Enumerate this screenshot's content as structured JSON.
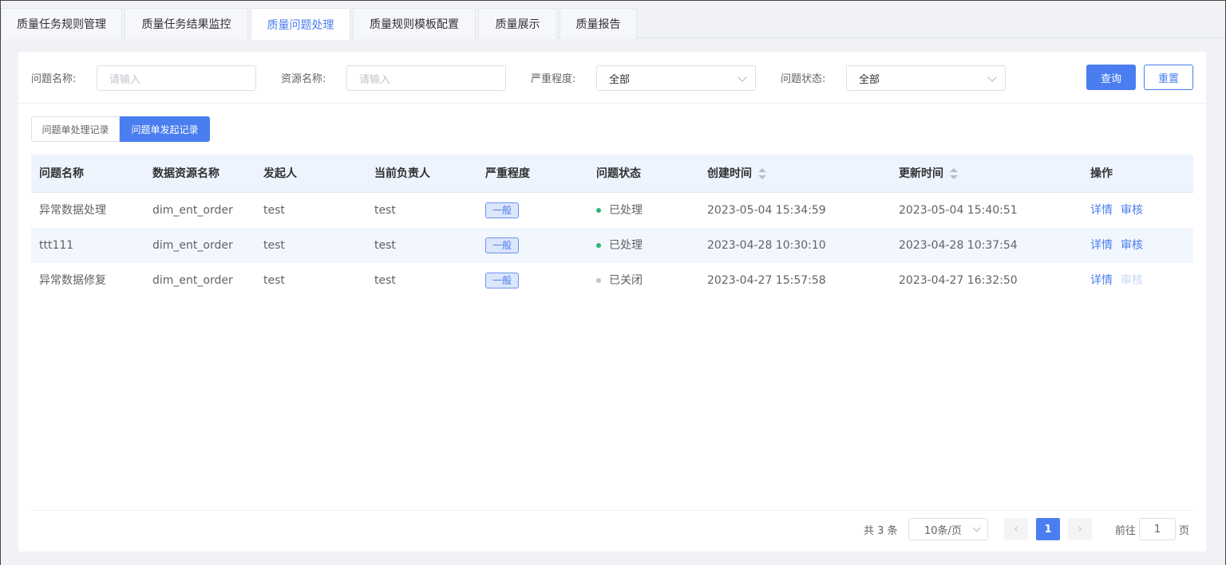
{
  "tabs": [
    {
      "label": "质量任务规则管理",
      "active": false
    },
    {
      "label": "质量任务结果监控",
      "active": false
    },
    {
      "label": "质量问题处理",
      "active": true
    },
    {
      "label": "质量规则模板配置",
      "active": false
    },
    {
      "label": "质量展示",
      "active": false
    },
    {
      "label": "质量报告",
      "active": false
    }
  ],
  "filters": {
    "issue_name_label": "问题名称:",
    "issue_name_placeholder": "请输入",
    "resource_name_label": "资源名称:",
    "resource_name_placeholder": "请输入",
    "severity_label": "严重程度:",
    "severity_value": "全部",
    "status_label": "问题状态:",
    "status_value": "全部",
    "query_button": "查询",
    "reset_button": "重置"
  },
  "segments": {
    "handled": "问题单处理记录",
    "initiated": "问题单发起记录",
    "active": "initiated"
  },
  "table": {
    "headers": [
      "问题名称",
      "数据资源名称",
      "发起人",
      "当前负责人",
      "严重程度",
      "问题状态",
      "创建时间",
      "更新时间",
      "操作"
    ],
    "rows": [
      {
        "name": "异常数据处理",
        "resource": "dim_ent_order",
        "initiator": "test",
        "owner": "test",
        "severity": "一般",
        "status": "已处理",
        "status_color": "#2bb673",
        "created": "2023-05-04 15:34:59",
        "updated": "2023-05-04 15:40:51",
        "detail": "详情",
        "review": "审核",
        "review_enabled": true
      },
      {
        "name": "ttt111",
        "resource": "dim_ent_order",
        "initiator": "test",
        "owner": "test",
        "severity": "一般",
        "status": "已处理",
        "status_color": "#2bb673",
        "created": "2023-04-28 10:30:10",
        "updated": "2023-04-28 10:37:54",
        "detail": "详情",
        "review": "审核",
        "review_enabled": true
      },
      {
        "name": "异常数据修复",
        "resource": "dim_ent_order",
        "initiator": "test",
        "owner": "test",
        "severity": "一般",
        "status": "已关闭",
        "status_color": "#c0c4cc",
        "created": "2023-04-27 15:57:58",
        "updated": "2023-04-27 16:32:50",
        "detail": "详情",
        "review": "审核",
        "review_enabled": false
      }
    ]
  },
  "pagination": {
    "total": "共 3 条",
    "page_size": "10条/页",
    "current_page": "1",
    "goto_prefix": "前往",
    "goto_value": "1",
    "goto_suffix": "页"
  },
  "colors": {
    "accent": "#4a7df0",
    "header_bg": "#eef4fd",
    "stripe": "#f2f7fd"
  }
}
